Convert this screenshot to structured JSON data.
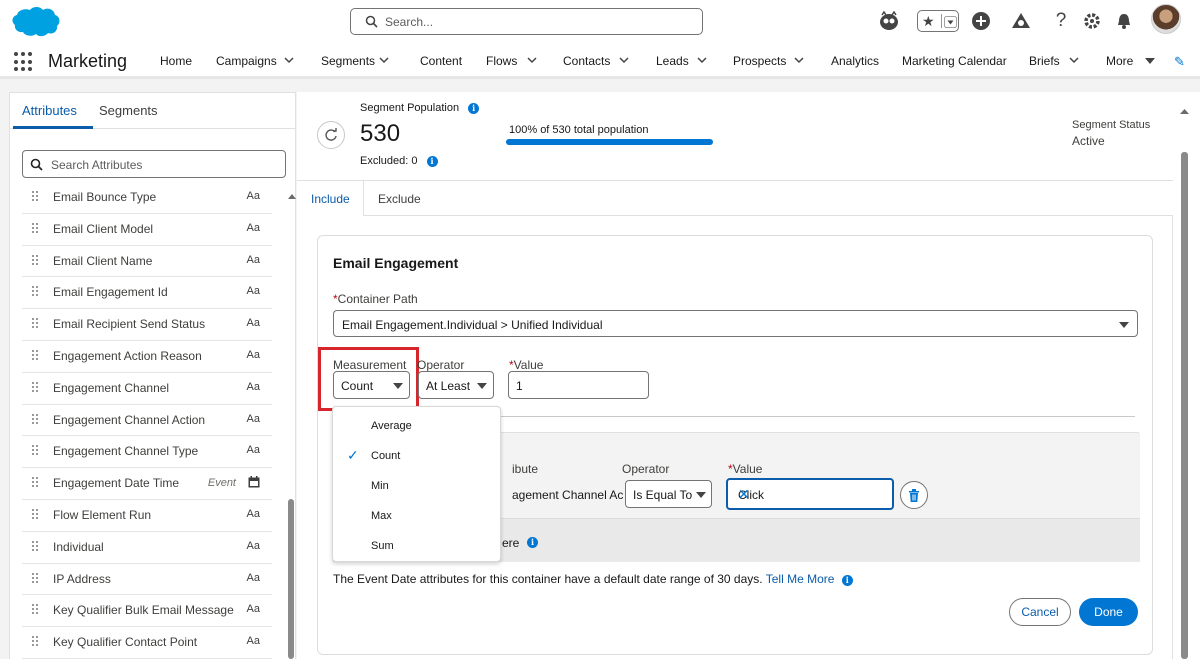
{
  "header": {
    "search_placeholder": "Search...",
    "colors": {
      "brand": "#00a1e0",
      "accent": "#0176d3",
      "highlight": "#d7262b"
    },
    "icons": [
      "einstein-icon",
      "favorites-icon",
      "add-icon",
      "trailhead-icon",
      "help-icon",
      "setup-gear-icon",
      "notification-bell-icon",
      "avatar"
    ]
  },
  "nav": {
    "app_name": "Marketing",
    "items": [
      {
        "label": "Home"
      },
      {
        "label": "Campaigns"
      },
      {
        "label": "Segments"
      },
      {
        "label": "Content"
      },
      {
        "label": "Flows"
      },
      {
        "label": "Contacts"
      },
      {
        "label": "Leads"
      },
      {
        "label": "Prospects"
      },
      {
        "label": "Analytics"
      },
      {
        "label": "Marketing Calendar"
      },
      {
        "label": "Briefs"
      },
      {
        "label": "More"
      }
    ]
  },
  "left": {
    "tabs": [
      {
        "label": "Attributes"
      },
      {
        "label": "Segments"
      }
    ],
    "search_placeholder": "Search Attributes",
    "attributes": [
      {
        "label": "Email Bounce Type",
        "type": "Aa"
      },
      {
        "label": "Email Client Model",
        "type": "Aa"
      },
      {
        "label": "Email Client Name",
        "type": "Aa"
      },
      {
        "label": "Email Engagement Id",
        "type": "Aa"
      },
      {
        "label": "Email Recipient Send Status",
        "type": "Aa"
      },
      {
        "label": "Engagement Action Reason",
        "type": "Aa"
      },
      {
        "label": "Engagement Channel",
        "type": "Aa"
      },
      {
        "label": "Engagement Channel Action",
        "type": "Aa"
      },
      {
        "label": "Engagement Channel Type",
        "type": "Aa"
      },
      {
        "label": "Engagement Date Time",
        "type": "calendar",
        "event": "Event"
      },
      {
        "label": "Flow Element Run",
        "type": "Aa"
      },
      {
        "label": "Individual",
        "type": "Aa"
      },
      {
        "label": "IP Address",
        "type": "Aa"
      },
      {
        "label": "Key Qualifier Bulk Email Message",
        "type": "Aa"
      },
      {
        "label": "Key Qualifier Contact Point",
        "type": "Aa"
      }
    ]
  },
  "population": {
    "title": "Segment Population",
    "count": "530",
    "excluded": "Excluded: 0",
    "percent_text": "100% of 530 total population",
    "percent": 100,
    "status_label": "Segment Status",
    "status_value": "Active"
  },
  "tabs": {
    "include": "Include",
    "exclude": "Exclude"
  },
  "container": {
    "title": "Email Engagement",
    "path_label": "Container Path",
    "path_value": "Email Engagement.Individual > Unified Individual",
    "measurement_label": "Measurement",
    "measurement_value": "Count",
    "operator_label": "Operator",
    "operator_value": "At Least",
    "value_label": "Value",
    "value_value": "1"
  },
  "inner": {
    "attribute_label_partial": "ibute",
    "attribute_value_partial": "agement Channel Ac",
    "operator_label": "Operator",
    "operator_value": "Is Equal To",
    "value_label": "Value",
    "value_value": "Click",
    "where_partial": "ere"
  },
  "note": {
    "text": "The Event Date attributes for this container have a default date range of 30 days.",
    "link": "Tell Me More"
  },
  "buttons": {
    "cancel": "Cancel",
    "done": "Done"
  },
  "measurement_options": [
    {
      "label": "Average",
      "selected": false
    },
    {
      "label": "Count",
      "selected": true
    },
    {
      "label": "Min",
      "selected": false
    },
    {
      "label": "Max",
      "selected": false
    },
    {
      "label": "Sum",
      "selected": false
    }
  ]
}
